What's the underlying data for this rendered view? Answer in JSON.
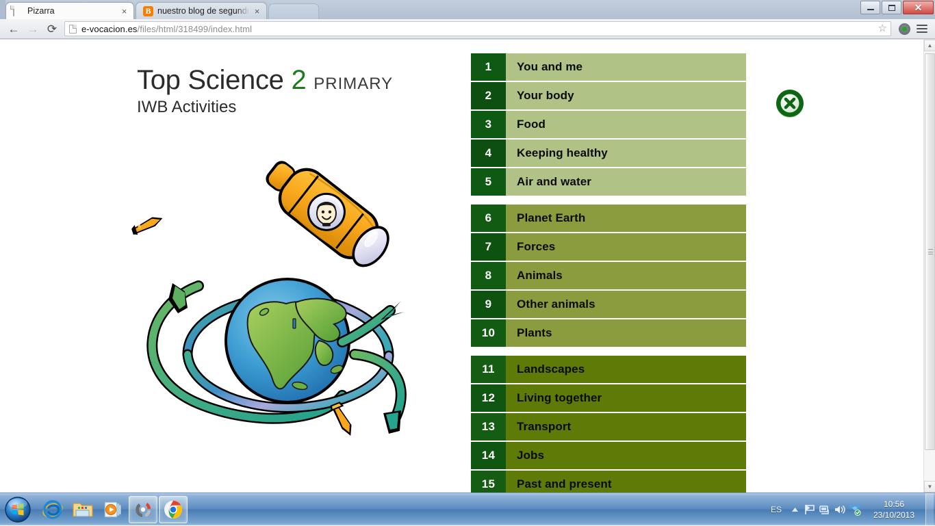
{
  "browser": {
    "tabs": [
      {
        "title": "Pizarra",
        "favicon": "page-icon",
        "active": true,
        "close_label": "×"
      },
      {
        "title": "nuestro blog de segundo",
        "favicon": "blogger-icon",
        "active": false,
        "close_label": "×"
      }
    ],
    "window_controls": {
      "minimize_label": "Minimize",
      "maximize_label": "Maximize",
      "close_label": "✕"
    },
    "toolbar": {
      "back_label": "←",
      "forward_label": "→",
      "reload_label": "⟳",
      "url_host": "e-vocacion.es",
      "url_path": "/files/html/318499/index.html",
      "star_label": "☆",
      "avatar_name": "user-avatar-icon",
      "menu_label": "Chrome menu"
    }
  },
  "page": {
    "title_main": "Top Science",
    "title_number": "2",
    "title_primary": "PRIMARY",
    "subtitle": "IWB Activities",
    "close_button_label": "✕",
    "illustration_name": "earth-globe-and-rocket-illustration"
  },
  "menu": {
    "groups": [
      {
        "id": "group-1",
        "items": [
          {
            "number": "1",
            "label": "You and me"
          },
          {
            "number": "2",
            "label": "Your body"
          },
          {
            "number": "3",
            "label": "Food"
          },
          {
            "number": "4",
            "label": "Keeping healthy"
          },
          {
            "number": "5",
            "label": "Air and water"
          }
        ]
      },
      {
        "id": "group-2",
        "items": [
          {
            "number": "6",
            "label": "Planet Earth"
          },
          {
            "number": "7",
            "label": "Forces"
          },
          {
            "number": "8",
            "label": "Animals"
          },
          {
            "number": "9",
            "label": "Other animals"
          },
          {
            "number": "10",
            "label": "Plants"
          }
        ]
      },
      {
        "id": "group-3",
        "items": [
          {
            "number": "11",
            "label": "Landscapes"
          },
          {
            "number": "12",
            "label": "Living together"
          },
          {
            "number": "13",
            "label": "Transport"
          },
          {
            "number": "14",
            "label": "Jobs"
          },
          {
            "number": "15",
            "label": "Past and present"
          }
        ]
      }
    ]
  },
  "scrollbar": {
    "up_label": "▲",
    "down_label": "▼"
  },
  "taskbar": {
    "start_label": "Start",
    "apps": [
      {
        "name": "internet-explorer",
        "running": false
      },
      {
        "name": "windows-explorer",
        "running": false
      },
      {
        "name": "windows-media-player",
        "running": false
      },
      {
        "name": "app-tool",
        "running": true
      },
      {
        "name": "google-chrome",
        "running": true
      }
    ],
    "tray": {
      "language": "ES",
      "show_hidden_label": "▲",
      "icons": [
        "action-center-flag-icon",
        "network-icon",
        "volume-icon",
        "dropbox-icon"
      ],
      "time": "10:56",
      "date": "23/10/2013"
    }
  },
  "colors": {
    "group1_bg": "#b1c287",
    "group2_bg": "#8a9c3d",
    "group3_bg": "#5e7a07",
    "number_bg": "#0d5b10",
    "accent_green": "#1d7a1d"
  }
}
